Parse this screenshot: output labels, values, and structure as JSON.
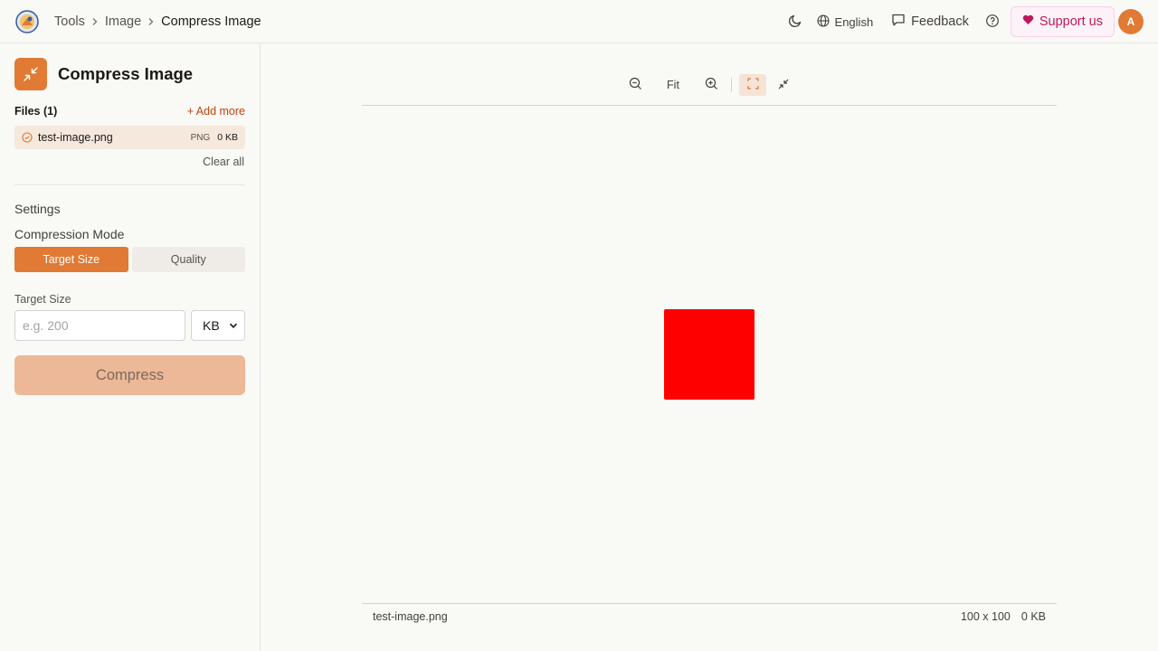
{
  "header": {
    "breadcrumb": [
      "Tools",
      "Image",
      "Compress Image"
    ],
    "language": "English",
    "feedback": "Feedback",
    "support": "Support us",
    "avatar_initial": "A",
    "icons": [
      "logo",
      "moon-icon",
      "globe-icon",
      "message-icon",
      "help-icon",
      "heart-icon"
    ]
  },
  "sidebar": {
    "tool_title": "Compress Image",
    "files_label": "Files (1)",
    "add_more": "+ Add more",
    "file": {
      "name": "test-image.png",
      "type": "PNG",
      "size": "0 KB"
    },
    "clear_all": "Clear all",
    "settings_label": "Settings",
    "mode_label": "Compression Mode",
    "modes": [
      "Target Size",
      "Quality"
    ],
    "active_mode": "Target Size",
    "target_label": "Target Size",
    "target_placeholder": "e.g. 200",
    "target_value": "",
    "unit_selected": "KB",
    "compress_label": "Compress"
  },
  "toolbar": {
    "fit_label": "Fit"
  },
  "preview": {
    "image_color": "#ff0000",
    "accent_color": "#e07a35"
  },
  "footer": {
    "file_name": "test-image.png",
    "dimensions": "100 x 100",
    "size": "0 KB"
  }
}
